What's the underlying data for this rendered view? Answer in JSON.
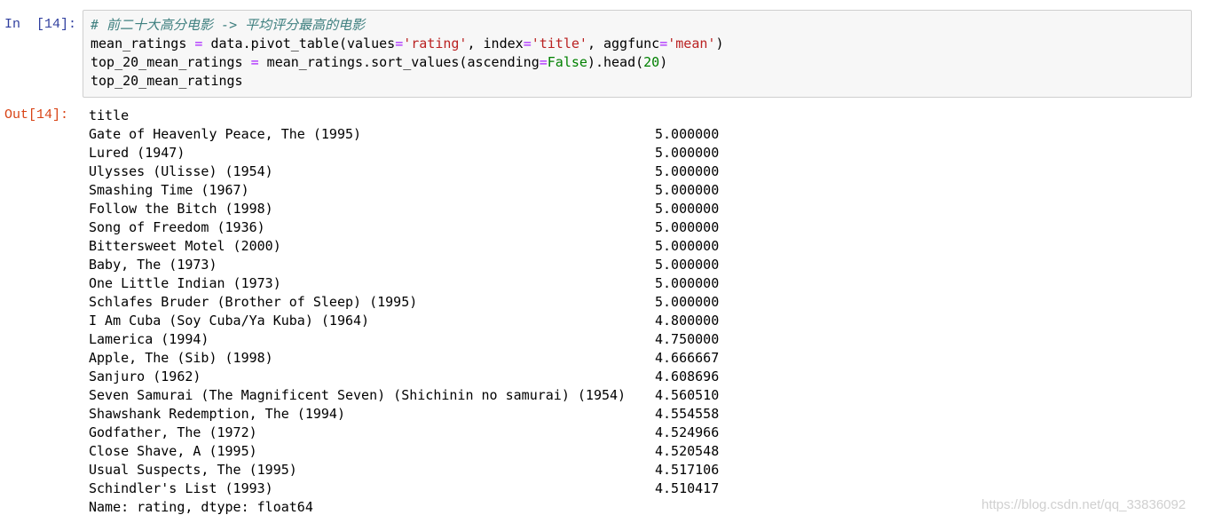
{
  "cell": {
    "in_prompt": "In  [14]:",
    "out_prompt": "Out[14]:",
    "code": {
      "comment": "# 前二十大高分电影 -> 平均评分最高的电影",
      "line2": {
        "a": "mean_ratings ",
        "eq": "=",
        "b": " data.pivot_table(values",
        "eq2": "=",
        "s1": "'rating'",
        "c": ", index",
        "eq3": "=",
        "s2": "'title'",
        "d": ", aggfunc",
        "eq4": "=",
        "s3": "'mean'",
        "e": ")"
      },
      "line3": {
        "a": "top_20_mean_ratings ",
        "eq": "=",
        "b": " mean_ratings.sort_values(ascending",
        "eq2": "=",
        "kw": "False",
        "c": ").head(",
        "num": "20",
        "d": ")"
      },
      "line4": "top_20_mean_ratings"
    },
    "output": {
      "header": "title",
      "rows": [
        {
          "title": "Gate of Heavenly Peace, The (1995)",
          "value": "5.000000"
        },
        {
          "title": "Lured (1947)",
          "value": "5.000000"
        },
        {
          "title": "Ulysses (Ulisse) (1954)",
          "value": "5.000000"
        },
        {
          "title": "Smashing Time (1967)",
          "value": "5.000000"
        },
        {
          "title": "Follow the Bitch (1998)",
          "value": "5.000000"
        },
        {
          "title": "Song of Freedom (1936)",
          "value": "5.000000"
        },
        {
          "title": "Bittersweet Motel (2000)",
          "value": "5.000000"
        },
        {
          "title": "Baby, The (1973)",
          "value": "5.000000"
        },
        {
          "title": "One Little Indian (1973)",
          "value": "5.000000"
        },
        {
          "title": "Schlafes Bruder (Brother of Sleep) (1995)",
          "value": "5.000000"
        },
        {
          "title": "I Am Cuba (Soy Cuba/Ya Kuba) (1964)",
          "value": "4.800000"
        },
        {
          "title": "Lamerica (1994)",
          "value": "4.750000"
        },
        {
          "title": "Apple, The (Sib) (1998)",
          "value": "4.666667"
        },
        {
          "title": "Sanjuro (1962)",
          "value": "4.608696"
        },
        {
          "title": "Seven Samurai (The Magnificent Seven) (Shichinin no samurai) (1954)",
          "value": "4.560510"
        },
        {
          "title": "Shawshank Redemption, The (1994)",
          "value": "4.554558"
        },
        {
          "title": "Godfather, The (1972)",
          "value": "4.524966"
        },
        {
          "title": "Close Shave, A (1995)",
          "value": "4.520548"
        },
        {
          "title": "Usual Suspects, The (1995)",
          "value": "4.517106"
        },
        {
          "title": "Schindler's List (1993)",
          "value": "4.510417"
        }
      ],
      "footer": "Name: rating, dtype: float64"
    }
  },
  "watermark": "https://blog.csdn.net/qq_33836092"
}
